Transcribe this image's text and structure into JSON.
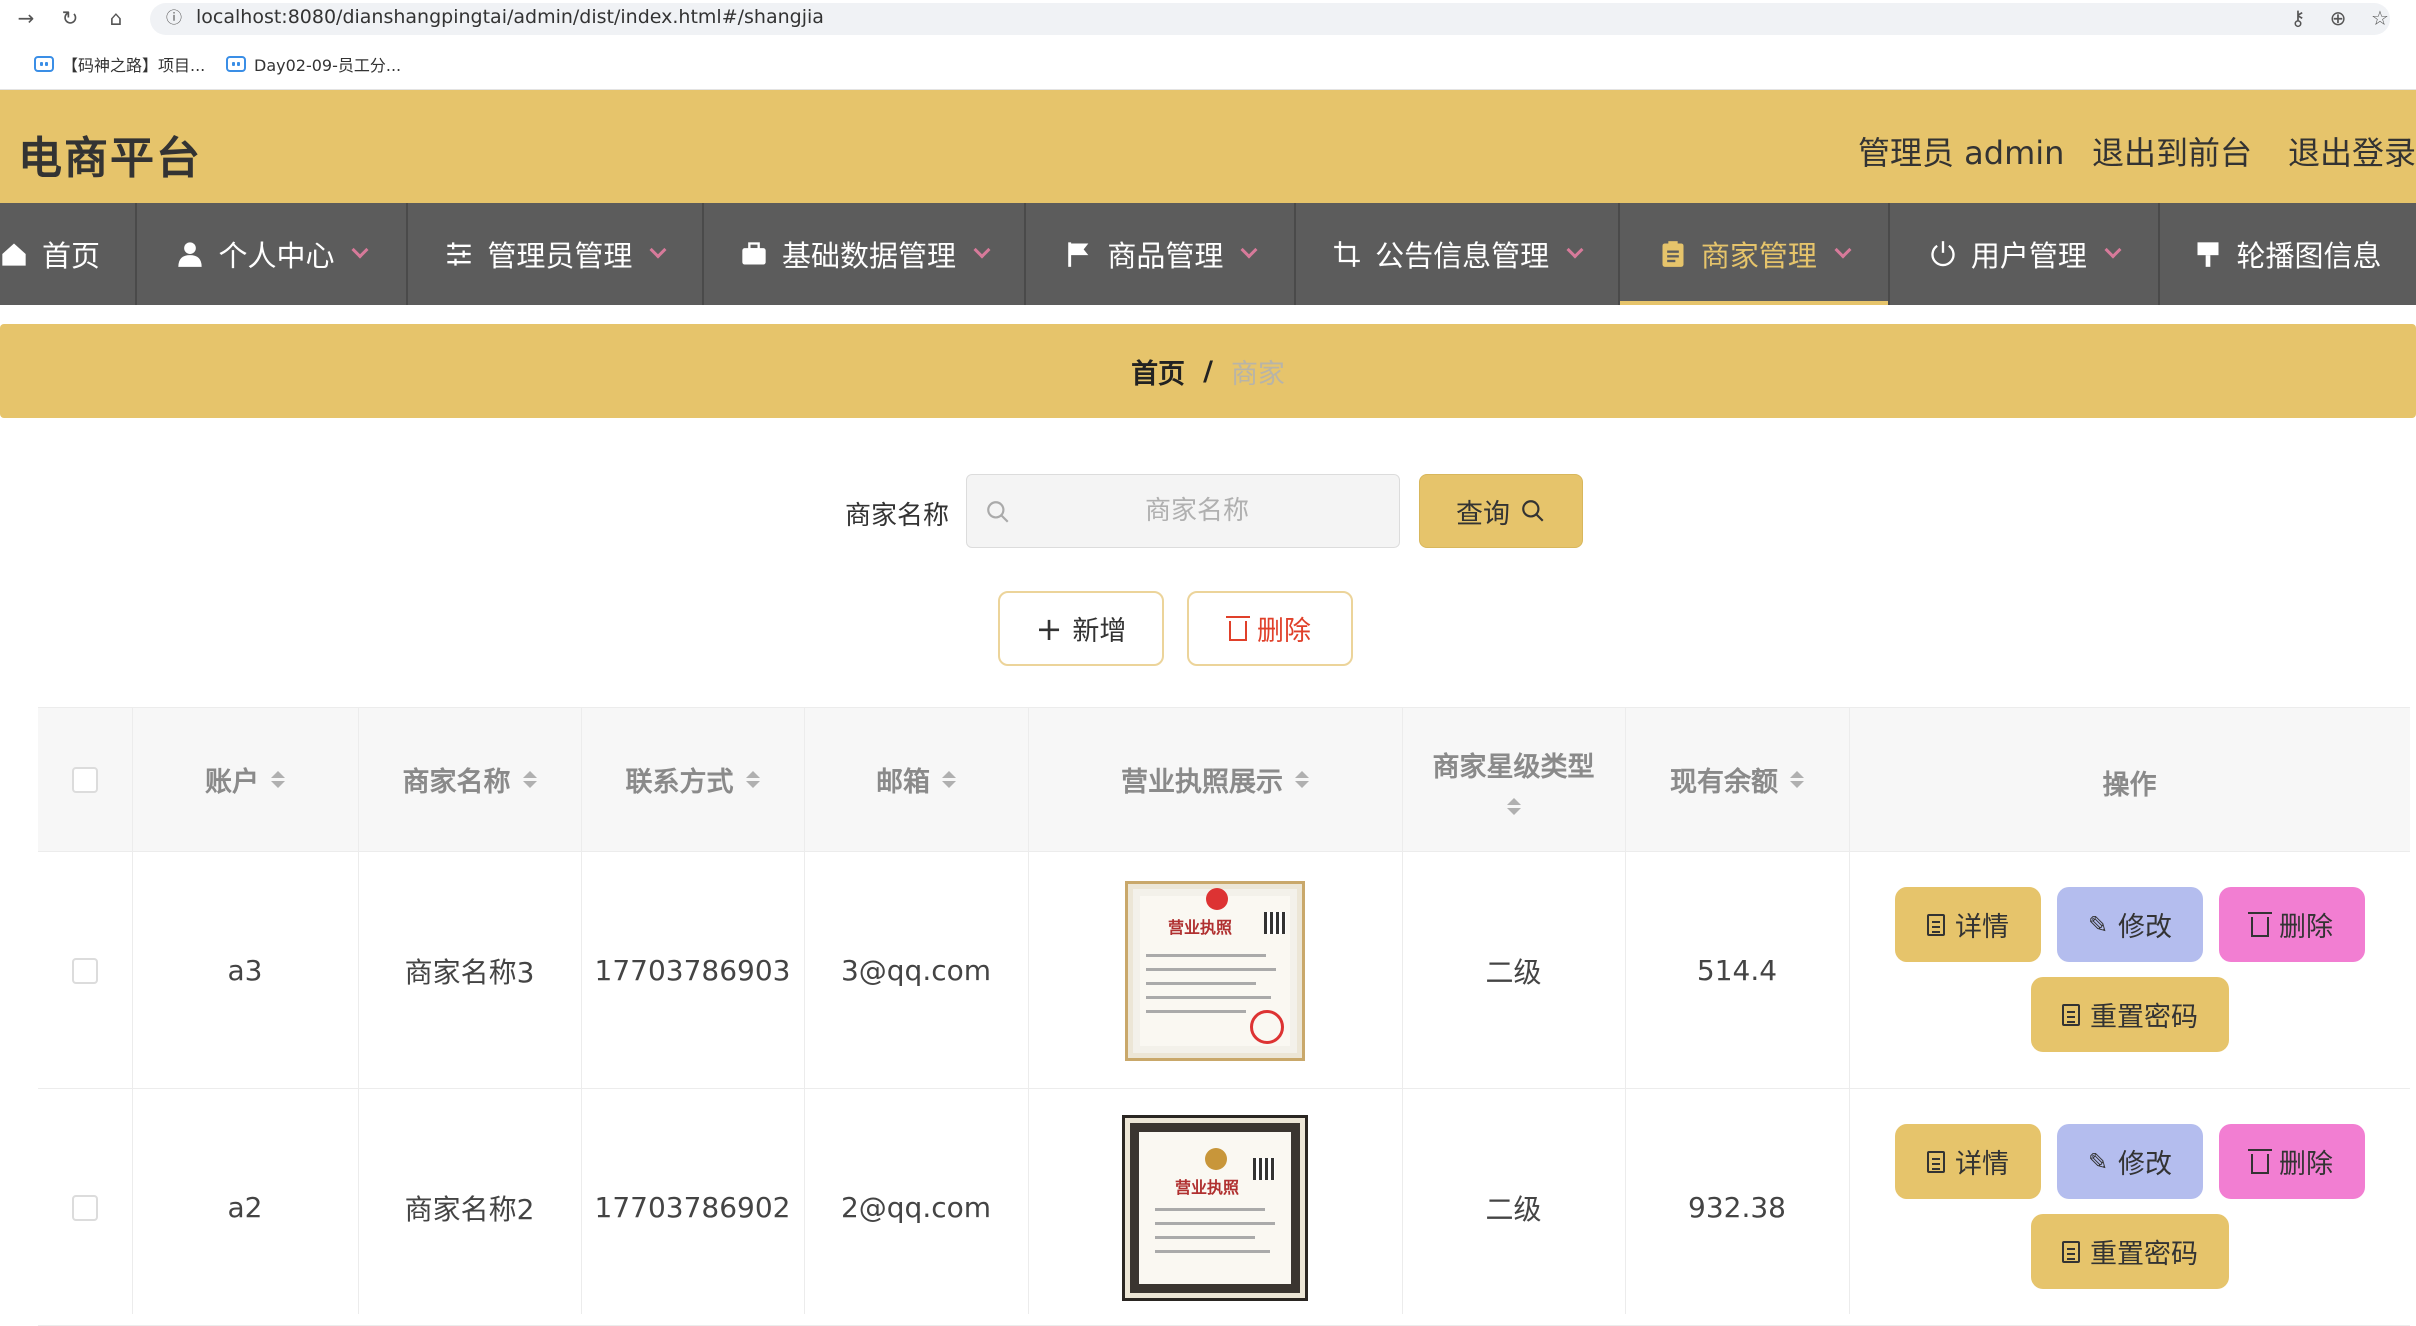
{
  "browser": {
    "url": "localhost:8080/dianshangpingtai/admin/dist/index.html#/shangjia",
    "bookmarks": [
      {
        "label": "【码神之路】项目..."
      },
      {
        "label": "Day02-09-员工分..."
      }
    ]
  },
  "header": {
    "title": "电商平台",
    "admin_label": "管理员 admin",
    "to_frontend": "退出到前台",
    "logout": "退出登录"
  },
  "nav": {
    "items": [
      {
        "label": "首页",
        "icon": "home-icon"
      },
      {
        "label": "个人中心",
        "icon": "user-icon"
      },
      {
        "label": "管理员管理",
        "icon": "sliders-icon"
      },
      {
        "label": "基础数据管理",
        "icon": "briefcase-icon"
      },
      {
        "label": "商品管理",
        "icon": "flag-icon"
      },
      {
        "label": "公告信息管理",
        "icon": "crop-icon"
      },
      {
        "label": "商家管理",
        "icon": "clipboard-icon",
        "active": true
      },
      {
        "label": "用户管理",
        "icon": "power-icon"
      },
      {
        "label": "轮播图信息",
        "icon": "brush-icon"
      }
    ]
  },
  "breadcrumb": {
    "home": "首页",
    "separator": "/",
    "current": "商家"
  },
  "search": {
    "label": "商家名称",
    "placeholder": "商家名称",
    "button": "查询"
  },
  "actions": {
    "add": "新增",
    "delete": "删除"
  },
  "table": {
    "headers": {
      "account": "账户",
      "name": "商家名称",
      "phone": "联系方式",
      "email": "邮箱",
      "license": "营业执照展示",
      "star": "商家星级类型",
      "balance": "现有余额",
      "ops": "操作"
    },
    "rows": [
      {
        "account": "a3",
        "name": "商家名称3",
        "phone": "17703786903",
        "email": "3@qq.com",
        "license_title": "营业执照",
        "star": "二级",
        "balance": "514.4"
      },
      {
        "account": "a2",
        "name": "商家名称2",
        "phone": "17703786902",
        "email": "2@qq.com",
        "license_title": "营业执照",
        "star": "二级",
        "balance": "932.38"
      }
    ],
    "op_labels": {
      "detail": "详情",
      "edit": "修改",
      "delete": "删除",
      "reset": "重置密码"
    }
  },
  "colors": {
    "accent": "#e6c46b",
    "nav_bg": "#5c5c5c",
    "edit_btn": "#b4bdee",
    "delete_btn": "#f27ed2",
    "danger_text": "#e0402a"
  }
}
